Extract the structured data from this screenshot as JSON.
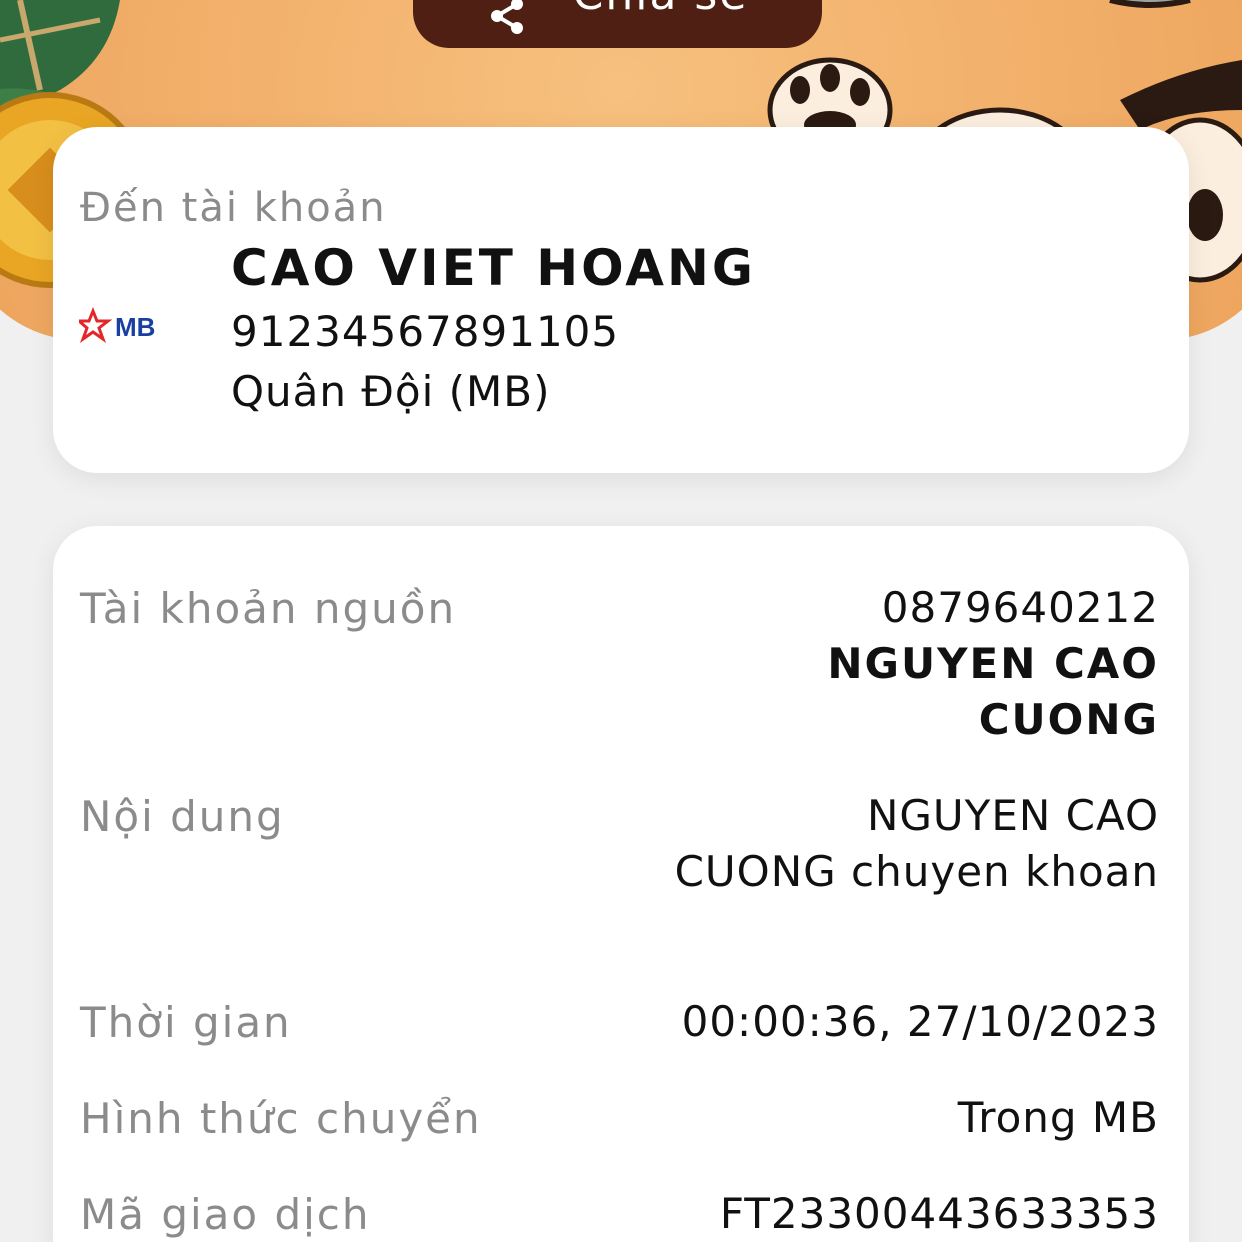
{
  "header": {
    "share_label": "Chia sẻ"
  },
  "recipient": {
    "section_label": "Đến tài khoản",
    "bank_logo_text": "MB",
    "name": "CAO VIET HOANG",
    "account_number": "91234567891105",
    "bank_name": "Quân Đội (MB)"
  },
  "details": {
    "source_label": "Tài khoản nguồn",
    "source_account": "0879640212",
    "source_name_line1": "NGUYEN CAO",
    "source_name_line2": "CUONG",
    "content_label": "Nội dung",
    "content_line1": "NGUYEN CAO",
    "content_line2": "CUONG chuyen khoan",
    "time_label": "Thời gian",
    "time_value": "00:00:36, 27/10/2023",
    "method_label": "Hình thức chuyển",
    "method_value": "Trong MB",
    "txn_label": "Mã giao dịch",
    "txn_value": "FT23300443633353"
  },
  "colors": {
    "brand_dark": "#4e1f12",
    "banner_orange": "#f0ac66",
    "mb_blue": "#1a3fa3",
    "mb_red": "#e5252a"
  },
  "icons": [
    "share-icon",
    "mb-logo-icon"
  ]
}
